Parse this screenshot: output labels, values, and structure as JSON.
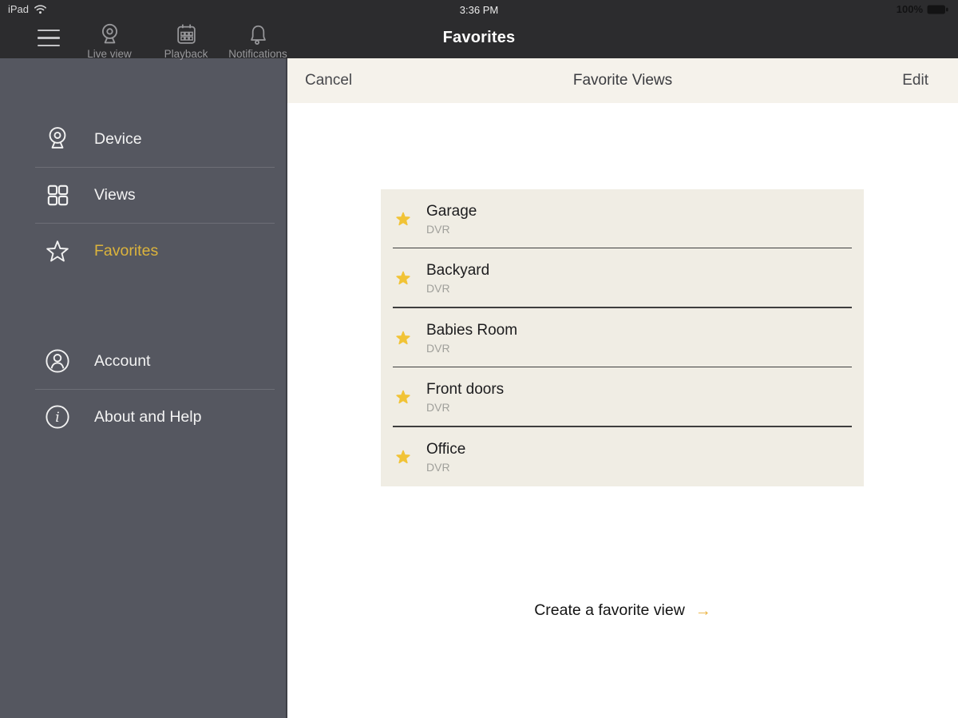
{
  "status_bar": {
    "device": "iPad",
    "time": "3:36 PM",
    "battery_percent": "100%"
  },
  "top_nav": {
    "title": "Favorites",
    "items": [
      {
        "label": "Live view",
        "icon": "webcam-icon"
      },
      {
        "label": "Playback",
        "icon": "calendar-icon"
      },
      {
        "label": "Notifications",
        "icon": "bell-icon"
      }
    ]
  },
  "sidebar": {
    "items": [
      {
        "label": "Device",
        "icon": "webcam-icon",
        "active": false
      },
      {
        "label": "Views",
        "icon": "grid-icon",
        "active": false
      },
      {
        "label": "Favorites",
        "icon": "star-icon",
        "active": true
      },
      {
        "label": "Account",
        "icon": "person-icon",
        "active": false
      },
      {
        "label": "About and Help",
        "icon": "info-icon",
        "active": false
      }
    ]
  },
  "content": {
    "toolbar": {
      "cancel": "Cancel",
      "title": "Favorite Views",
      "edit": "Edit"
    },
    "favorites": [
      {
        "name": "Garage",
        "type": "DVR"
      },
      {
        "name": "Backyard",
        "type": "DVR"
      },
      {
        "name": "Babies Room",
        "type": "DVR"
      },
      {
        "name": "Front doors",
        "type": "DVR"
      },
      {
        "name": "Office",
        "type": "DVR"
      }
    ],
    "create_link": {
      "label": "Create a favorite view",
      "arrow": "→"
    }
  },
  "colors": {
    "header_bg": "#2c2c2e",
    "sidebar_bg": "#555760",
    "toolbar_bg": "#f5f2eb",
    "panel_bg": "#f0ede4",
    "accent_gold": "#f1c336",
    "active_label_yellow": "#dcb43c",
    "arrow_gold": "#eab23f"
  }
}
